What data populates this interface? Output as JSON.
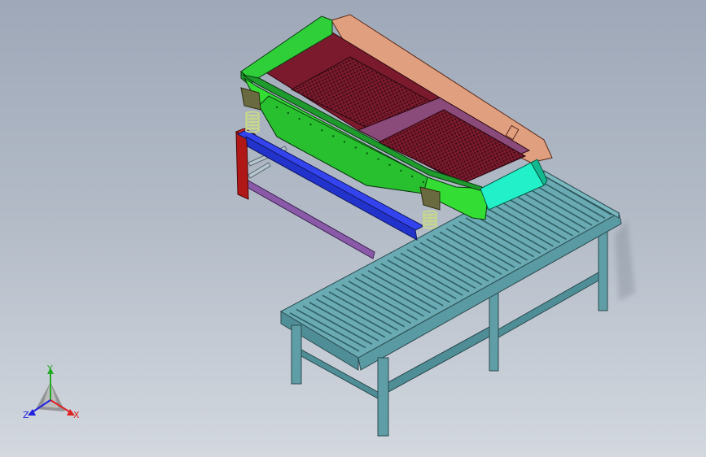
{
  "viewport": {
    "background_top": "#9ea8b8",
    "background_bottom": "#d3d8df"
  },
  "model": {
    "parts": [
      "roller-conveyor",
      "vibrating-screen",
      "support-frame",
      "springs"
    ],
    "colors": {
      "conveyor": "#5f9ea6",
      "conveyor_dark": "#3f7b84",
      "screen_body": "#33dd33",
      "screen_dark": "#1f9a2c",
      "side_panel": "#e0a080",
      "deck": "#7a1a2c",
      "deck_mesh": "#3a0c18",
      "lower_deck": "#8a4a7a",
      "outlet": "#22f0c8",
      "frame_red": "#b01818",
      "frame_blue": "#2233dd",
      "frame_purple": "#8a5aa8",
      "spring": "#c8d88a"
    }
  },
  "triad": {
    "x_label": "X",
    "y_label": "Y",
    "z_label": "Z",
    "x_color": "#dd2222",
    "y_color": "#22aa22",
    "z_color": "#2222dd"
  }
}
